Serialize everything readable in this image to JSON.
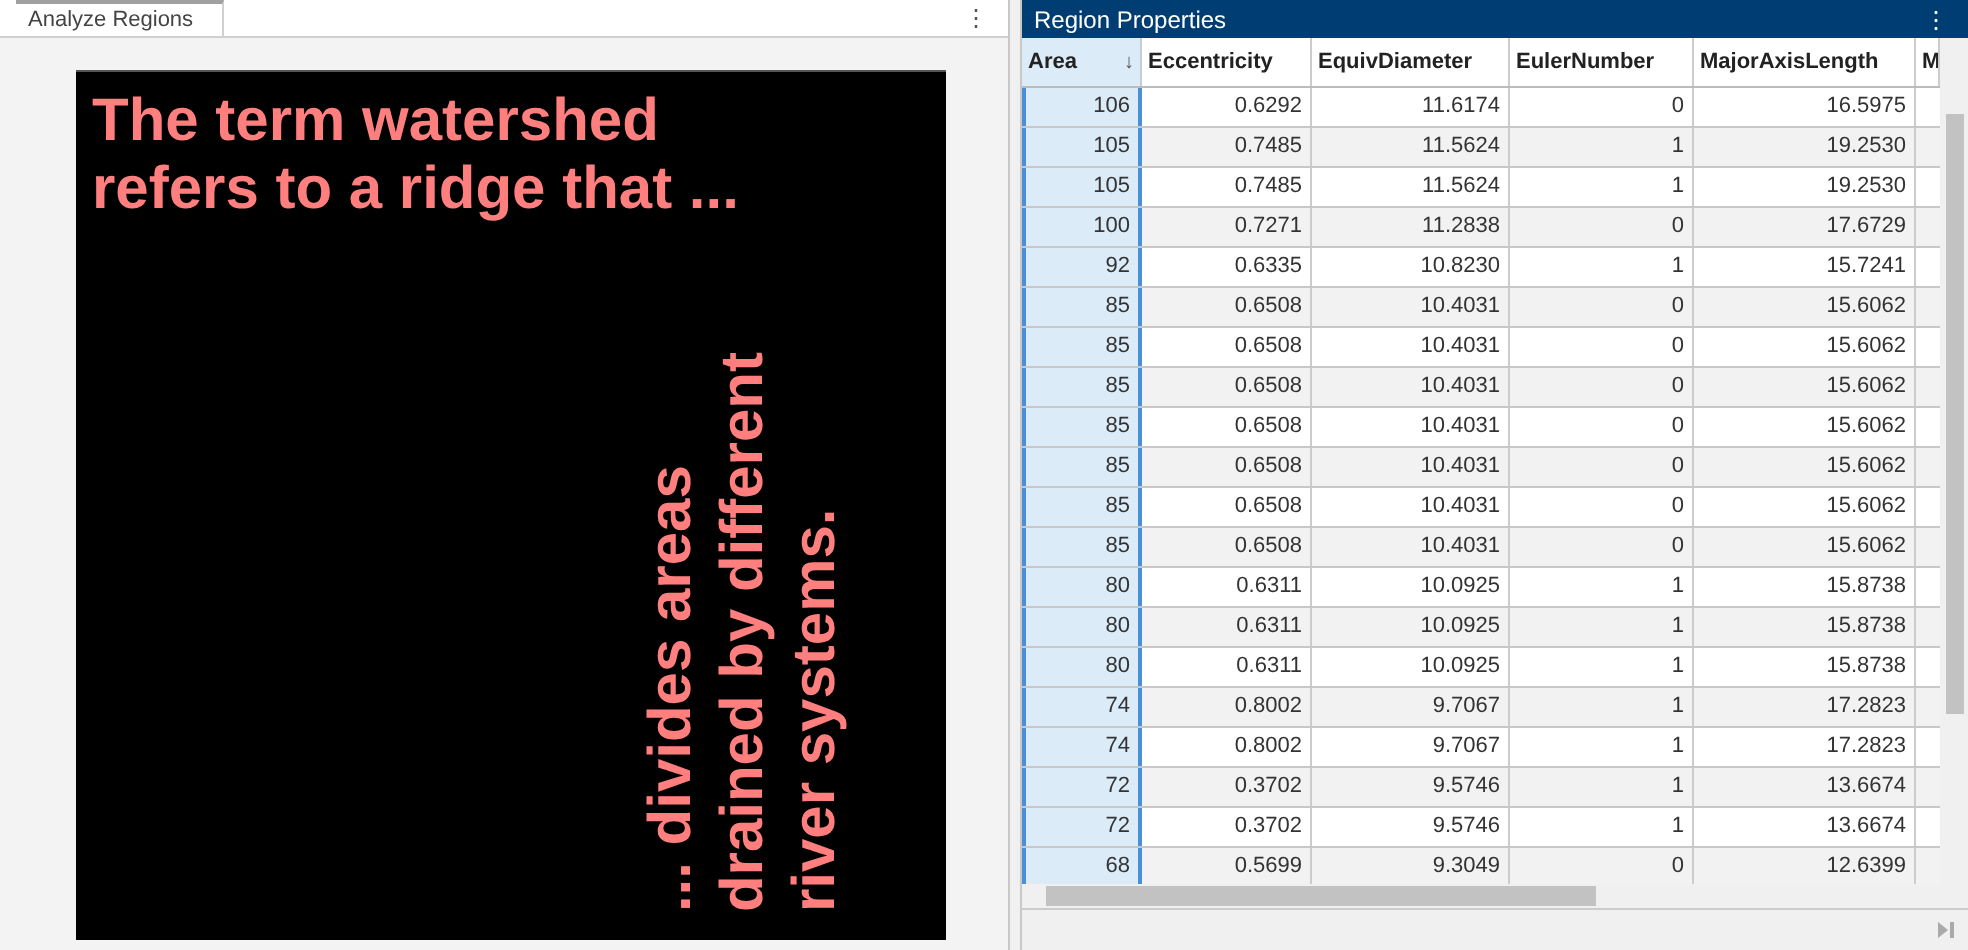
{
  "left_panel": {
    "tab": {
      "label": "Analyze Regions",
      "selected": true
    },
    "menu": "⋮",
    "image_text": {
      "top": [
        "The term watershed",
        "refers to a ridge that ..."
      ],
      "vertical": [
        "... divides areas",
        "drained by different",
        "river systems."
      ]
    }
  },
  "right_panel": {
    "title": "Region Properties",
    "menu": "⋮",
    "table": {
      "sort_indicator": "↓",
      "columns": [
        {
          "label": "Area",
          "selected": true
        },
        {
          "label": "Eccentricity",
          "selected": false
        },
        {
          "label": "EquivDiameter",
          "selected": false
        },
        {
          "label": "EulerNumber",
          "selected": false
        },
        {
          "label": "MajorAxisLength",
          "selected": false
        },
        {
          "label": "M",
          "selected": false
        }
      ],
      "rows": [
        [
          "106",
          "0.6292",
          "11.6174",
          "0",
          "16.5975"
        ],
        [
          "105",
          "0.7485",
          "11.5624",
          "1",
          "19.2530"
        ],
        [
          "105",
          "0.7485",
          "11.5624",
          "1",
          "19.2530"
        ],
        [
          "100",
          "0.7271",
          "11.2838",
          "0",
          "17.6729"
        ],
        [
          "92",
          "0.6335",
          "10.8230",
          "1",
          "15.7241"
        ],
        [
          "85",
          "0.6508",
          "10.4031",
          "0",
          "15.6062"
        ],
        [
          "85",
          "0.6508",
          "10.4031",
          "0",
          "15.6062"
        ],
        [
          "85",
          "0.6508",
          "10.4031",
          "0",
          "15.6062"
        ],
        [
          "85",
          "0.6508",
          "10.4031",
          "0",
          "15.6062"
        ],
        [
          "85",
          "0.6508",
          "10.4031",
          "0",
          "15.6062"
        ],
        [
          "85",
          "0.6508",
          "10.4031",
          "0",
          "15.6062"
        ],
        [
          "85",
          "0.6508",
          "10.4031",
          "0",
          "15.6062"
        ],
        [
          "80",
          "0.6311",
          "10.0925",
          "1",
          "15.8738"
        ],
        [
          "80",
          "0.6311",
          "10.0925",
          "1",
          "15.8738"
        ],
        [
          "80",
          "0.6311",
          "10.0925",
          "1",
          "15.8738"
        ],
        [
          "74",
          "0.8002",
          "9.7067",
          "1",
          "17.2823"
        ],
        [
          "74",
          "0.8002",
          "9.7067",
          "1",
          "17.2823"
        ],
        [
          "72",
          "0.3702",
          "9.5746",
          "1",
          "13.6674"
        ],
        [
          "72",
          "0.3702",
          "9.5746",
          "1",
          "13.6674"
        ],
        [
          "68",
          "0.5699",
          "9.3049",
          "0",
          "12.6399"
        ]
      ]
    }
  }
}
